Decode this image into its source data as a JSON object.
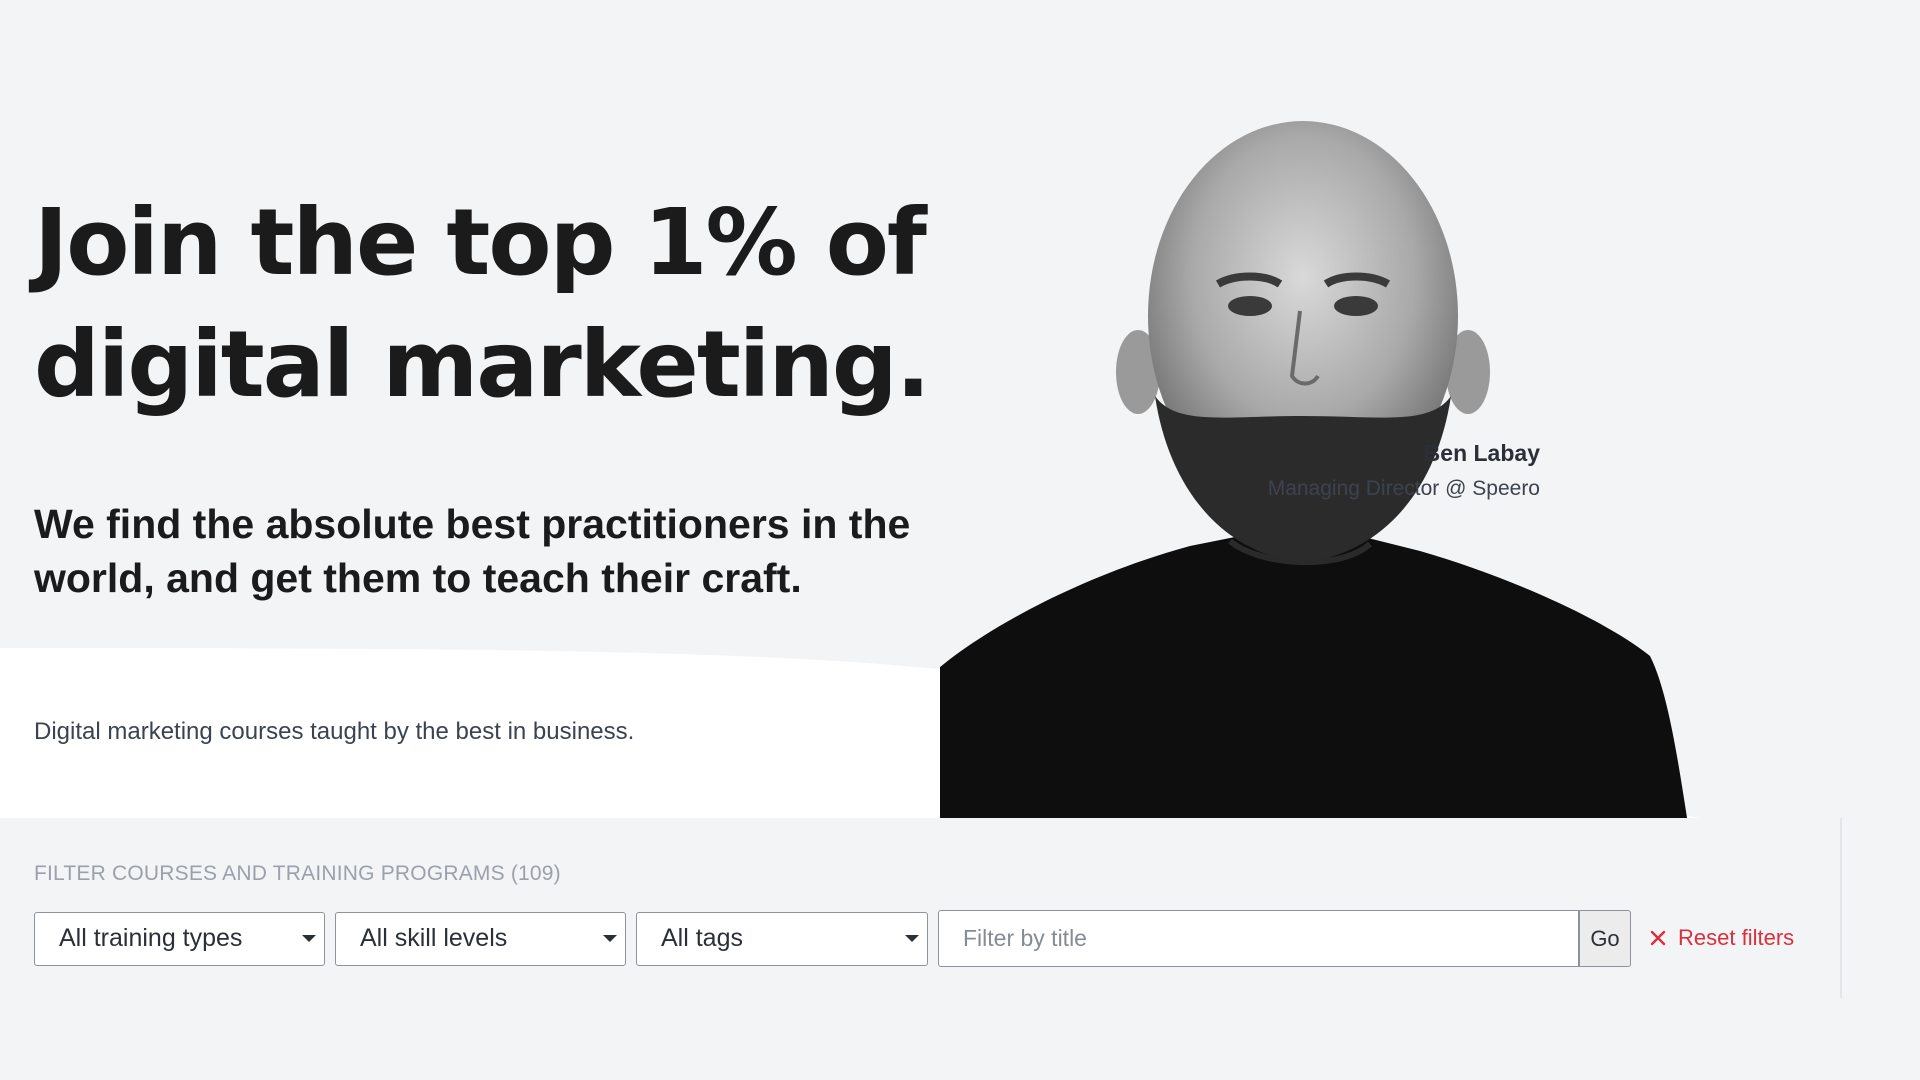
{
  "hero": {
    "title_line1": "Join the top 1% of",
    "title_line2": "digital marketing.",
    "subtitle_line1": "We find the absolute best practitioners in the",
    "subtitle_line2": "world, and get them to teach their craft.",
    "description": "Digital marketing courses taught by the best in business."
  },
  "featured_person": {
    "name": "Ben Labay",
    "role": "Managing Director @ Speero"
  },
  "filters": {
    "heading": "FILTER COURSES AND TRAINING PROGRAMS (109)",
    "training_type": {
      "selected": "All training types"
    },
    "skill_level": {
      "selected": "All skill levels"
    },
    "tags": {
      "selected": "All tags"
    },
    "title_search": {
      "placeholder": "Filter by title",
      "value": ""
    },
    "go_label": "Go",
    "reset_label": "Reset filters"
  },
  "colors": {
    "background": "#f3f4f6",
    "text": "#1b1b1b",
    "reset_accent": "#d9303e"
  },
  "icons": {
    "reset": "close-icon",
    "dropdown": "chevron-down-icon"
  }
}
